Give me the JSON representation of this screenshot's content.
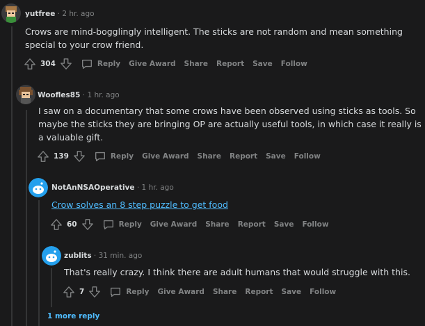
{
  "comments": [
    {
      "user": "yutfree",
      "time": "2 hr. ago",
      "text": "Crows are mind-bogglingly intelligent. The sticks are not random and mean something special to your crow friend.",
      "score": "304"
    },
    {
      "user": "Woofles85",
      "time": "1 hr. ago",
      "text": "I saw on a documentary that some crows have been observed using sticks as tools. So maybe the sticks they are bringing OP are actually useful tools, in which case it really is a valuable gift.",
      "score": "139"
    },
    {
      "user": "NotAnNSAOperative",
      "time": "1 hr. ago",
      "link_text": "Crow solves an 8 step puzzle to get food",
      "score": "60"
    },
    {
      "user": "zublits",
      "time": "31 min. ago",
      "text": "That's really crazy. I think there are adult humans that would struggle with this.",
      "score": "7"
    }
  ],
  "actions": {
    "reply": "Reply",
    "give_award": "Give Award",
    "share": "Share",
    "report": "Report",
    "save": "Save",
    "follow": "Follow"
  },
  "more_replies": "1 more reply",
  "separator": "·",
  "colors": {
    "background": "#1a1a1b",
    "text": "#d7dadc",
    "muted": "#818384",
    "link": "#4fbcff",
    "thread": "#343536",
    "snoo": "#24a0ed"
  },
  "icons": {
    "upvote": "arrow-up-icon",
    "downvote": "arrow-down-icon",
    "reply": "chat-bubble-icon"
  }
}
